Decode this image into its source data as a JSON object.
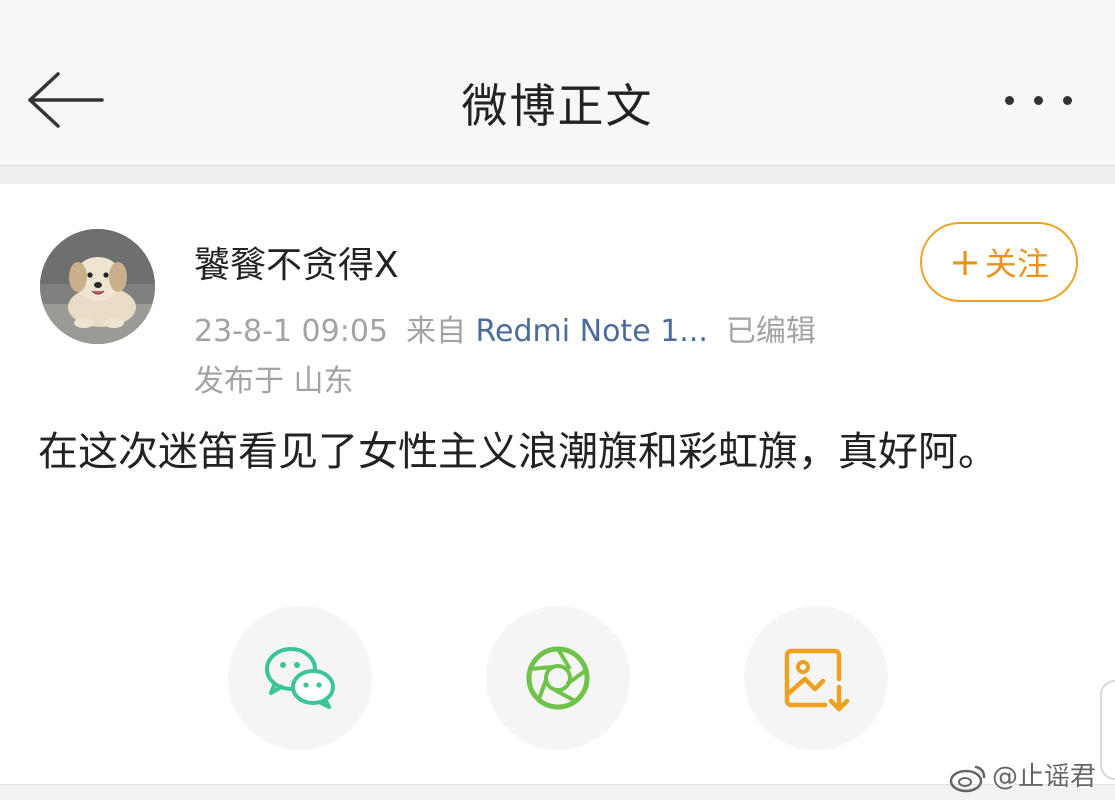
{
  "nav": {
    "title": "微博正文",
    "back_icon": "arrow-left-icon",
    "more_icon": "more-dots-icon"
  },
  "post": {
    "author": "饕餮不贪得X",
    "timestamp": "23-8-1 09:05",
    "source_prefix": "来自",
    "source": "Redmi Note 1...",
    "edited": "已编辑",
    "location_prefix": "发布于",
    "location": "山东",
    "text": "在这次迷笛看见了女性主义浪潮旗和彩虹旗，真好阿。"
  },
  "follow_button": {
    "plus": "+",
    "label": "关注",
    "color": "#f0a020"
  },
  "share": [
    {
      "icon": "wechat-icon",
      "color": "#3cc39a"
    },
    {
      "icon": "moments-camera-icon",
      "color": "#6fc24a"
    },
    {
      "icon": "save-image-icon",
      "color": "#f0a020"
    }
  ],
  "watermark": {
    "text": "@止谣君"
  }
}
